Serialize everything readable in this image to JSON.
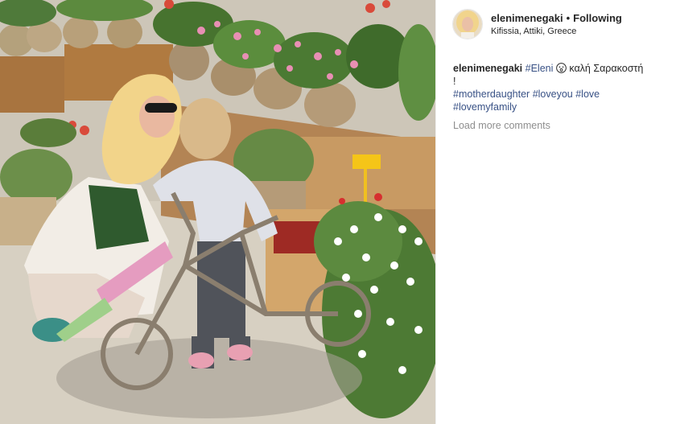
{
  "post": {
    "username": "elenimenegaki",
    "follow_separator": "•",
    "follow_status": "Following",
    "location": "Kifissia, Attiki, Greece",
    "caption": {
      "username": "elenimenegaki",
      "tag_eleni": "#Eleni",
      "emoji": "kiss-face-emoji",
      "text": "καλή Σαρακοστή",
      "exclamation": "!",
      "tags": [
        "#motherdaughter",
        "#loveyou",
        "#love",
        "#lovemyfamily"
      ]
    },
    "load_more": "Load more comments"
  },
  "colors": {
    "link": "#385185",
    "muted": "#8e8e8e",
    "text": "#262626"
  }
}
